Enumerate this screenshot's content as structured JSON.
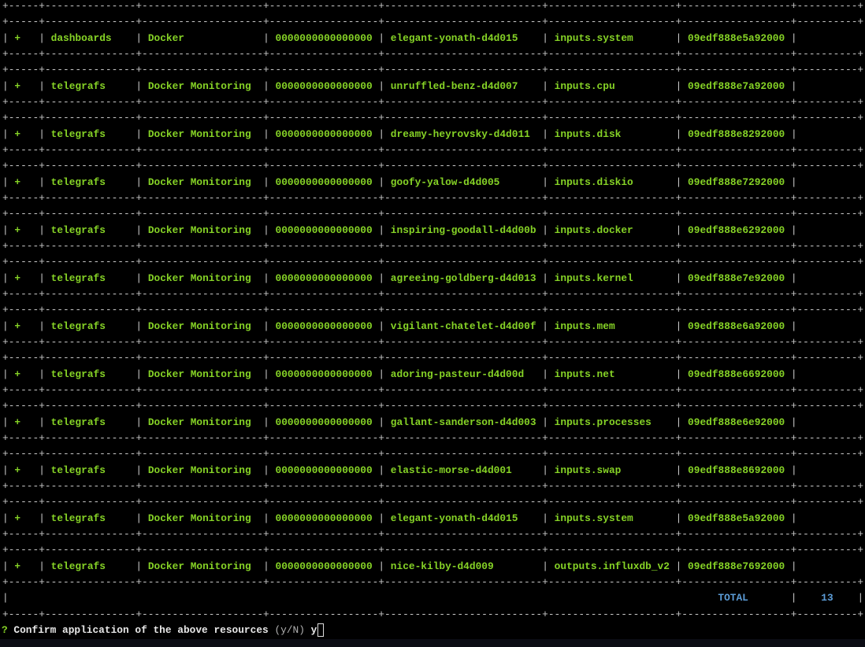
{
  "table": {
    "rows": [
      {
        "action": "+",
        "kind": "dashboards",
        "name": "Docker",
        "id": "0000000000000000",
        "template": "elegant-yonath-d4d015",
        "resource": "inputs.system",
        "stack": "09edf888e5a92000"
      },
      {
        "action": "+",
        "kind": "telegrafs",
        "name": "Docker Monitoring",
        "id": "0000000000000000",
        "template": "unruffled-benz-d4d007",
        "resource": "inputs.cpu",
        "stack": "09edf888e7a92000"
      },
      {
        "action": "+",
        "kind": "telegrafs",
        "name": "Docker Monitoring",
        "id": "0000000000000000",
        "template": "dreamy-heyrovsky-d4d011",
        "resource": "inputs.disk",
        "stack": "09edf888e8292000"
      },
      {
        "action": "+",
        "kind": "telegrafs",
        "name": "Docker Monitoring",
        "id": "0000000000000000",
        "template": "goofy-yalow-d4d005",
        "resource": "inputs.diskio",
        "stack": "09edf888e7292000"
      },
      {
        "action": "+",
        "kind": "telegrafs",
        "name": "Docker Monitoring",
        "id": "0000000000000000",
        "template": "inspiring-goodall-d4d00b",
        "resource": "inputs.docker",
        "stack": "09edf888e6292000"
      },
      {
        "action": "+",
        "kind": "telegrafs",
        "name": "Docker Monitoring",
        "id": "0000000000000000",
        "template": "agreeing-goldberg-d4d013",
        "resource": "inputs.kernel",
        "stack": "09edf888e7e92000"
      },
      {
        "action": "+",
        "kind": "telegrafs",
        "name": "Docker Monitoring",
        "id": "0000000000000000",
        "template": "vigilant-chatelet-d4d00f",
        "resource": "inputs.mem",
        "stack": "09edf888e6a92000"
      },
      {
        "action": "+",
        "kind": "telegrafs",
        "name": "Docker Monitoring",
        "id": "0000000000000000",
        "template": "adoring-pasteur-d4d00d",
        "resource": "inputs.net",
        "stack": "09edf888e6692000"
      },
      {
        "action": "+",
        "kind": "telegrafs",
        "name": "Docker Monitoring",
        "id": "0000000000000000",
        "template": "gallant-sanderson-d4d003",
        "resource": "inputs.processes",
        "stack": "09edf888e6e92000"
      },
      {
        "action": "+",
        "kind": "telegrafs",
        "name": "Docker Monitoring",
        "id": "0000000000000000",
        "template": "elastic-morse-d4d001",
        "resource": "inputs.swap",
        "stack": "09edf888e8692000"
      },
      {
        "action": "+",
        "kind": "telegrafs",
        "name": "Docker Monitoring",
        "id": "0000000000000000",
        "template": "elegant-yonath-d4d015",
        "resource": "inputs.system",
        "stack": "09edf888e5a92000"
      },
      {
        "action": "+",
        "kind": "telegrafs",
        "name": "Docker Monitoring",
        "id": "0000000000000000",
        "template": "nice-kilby-d4d009",
        "resource": "outputs.influxdb_v2",
        "stack": "09edf888e7692000"
      }
    ],
    "total_label": "TOTAL",
    "total_value": "13"
  },
  "prompt": {
    "marker": "?",
    "question": "Confirm application of the above resources",
    "hint": "(y/N)",
    "input": "y"
  },
  "colors": {
    "text": "#86d326",
    "border": "#c8c8c8",
    "total": "#5b9bd5",
    "background": "#000000"
  }
}
